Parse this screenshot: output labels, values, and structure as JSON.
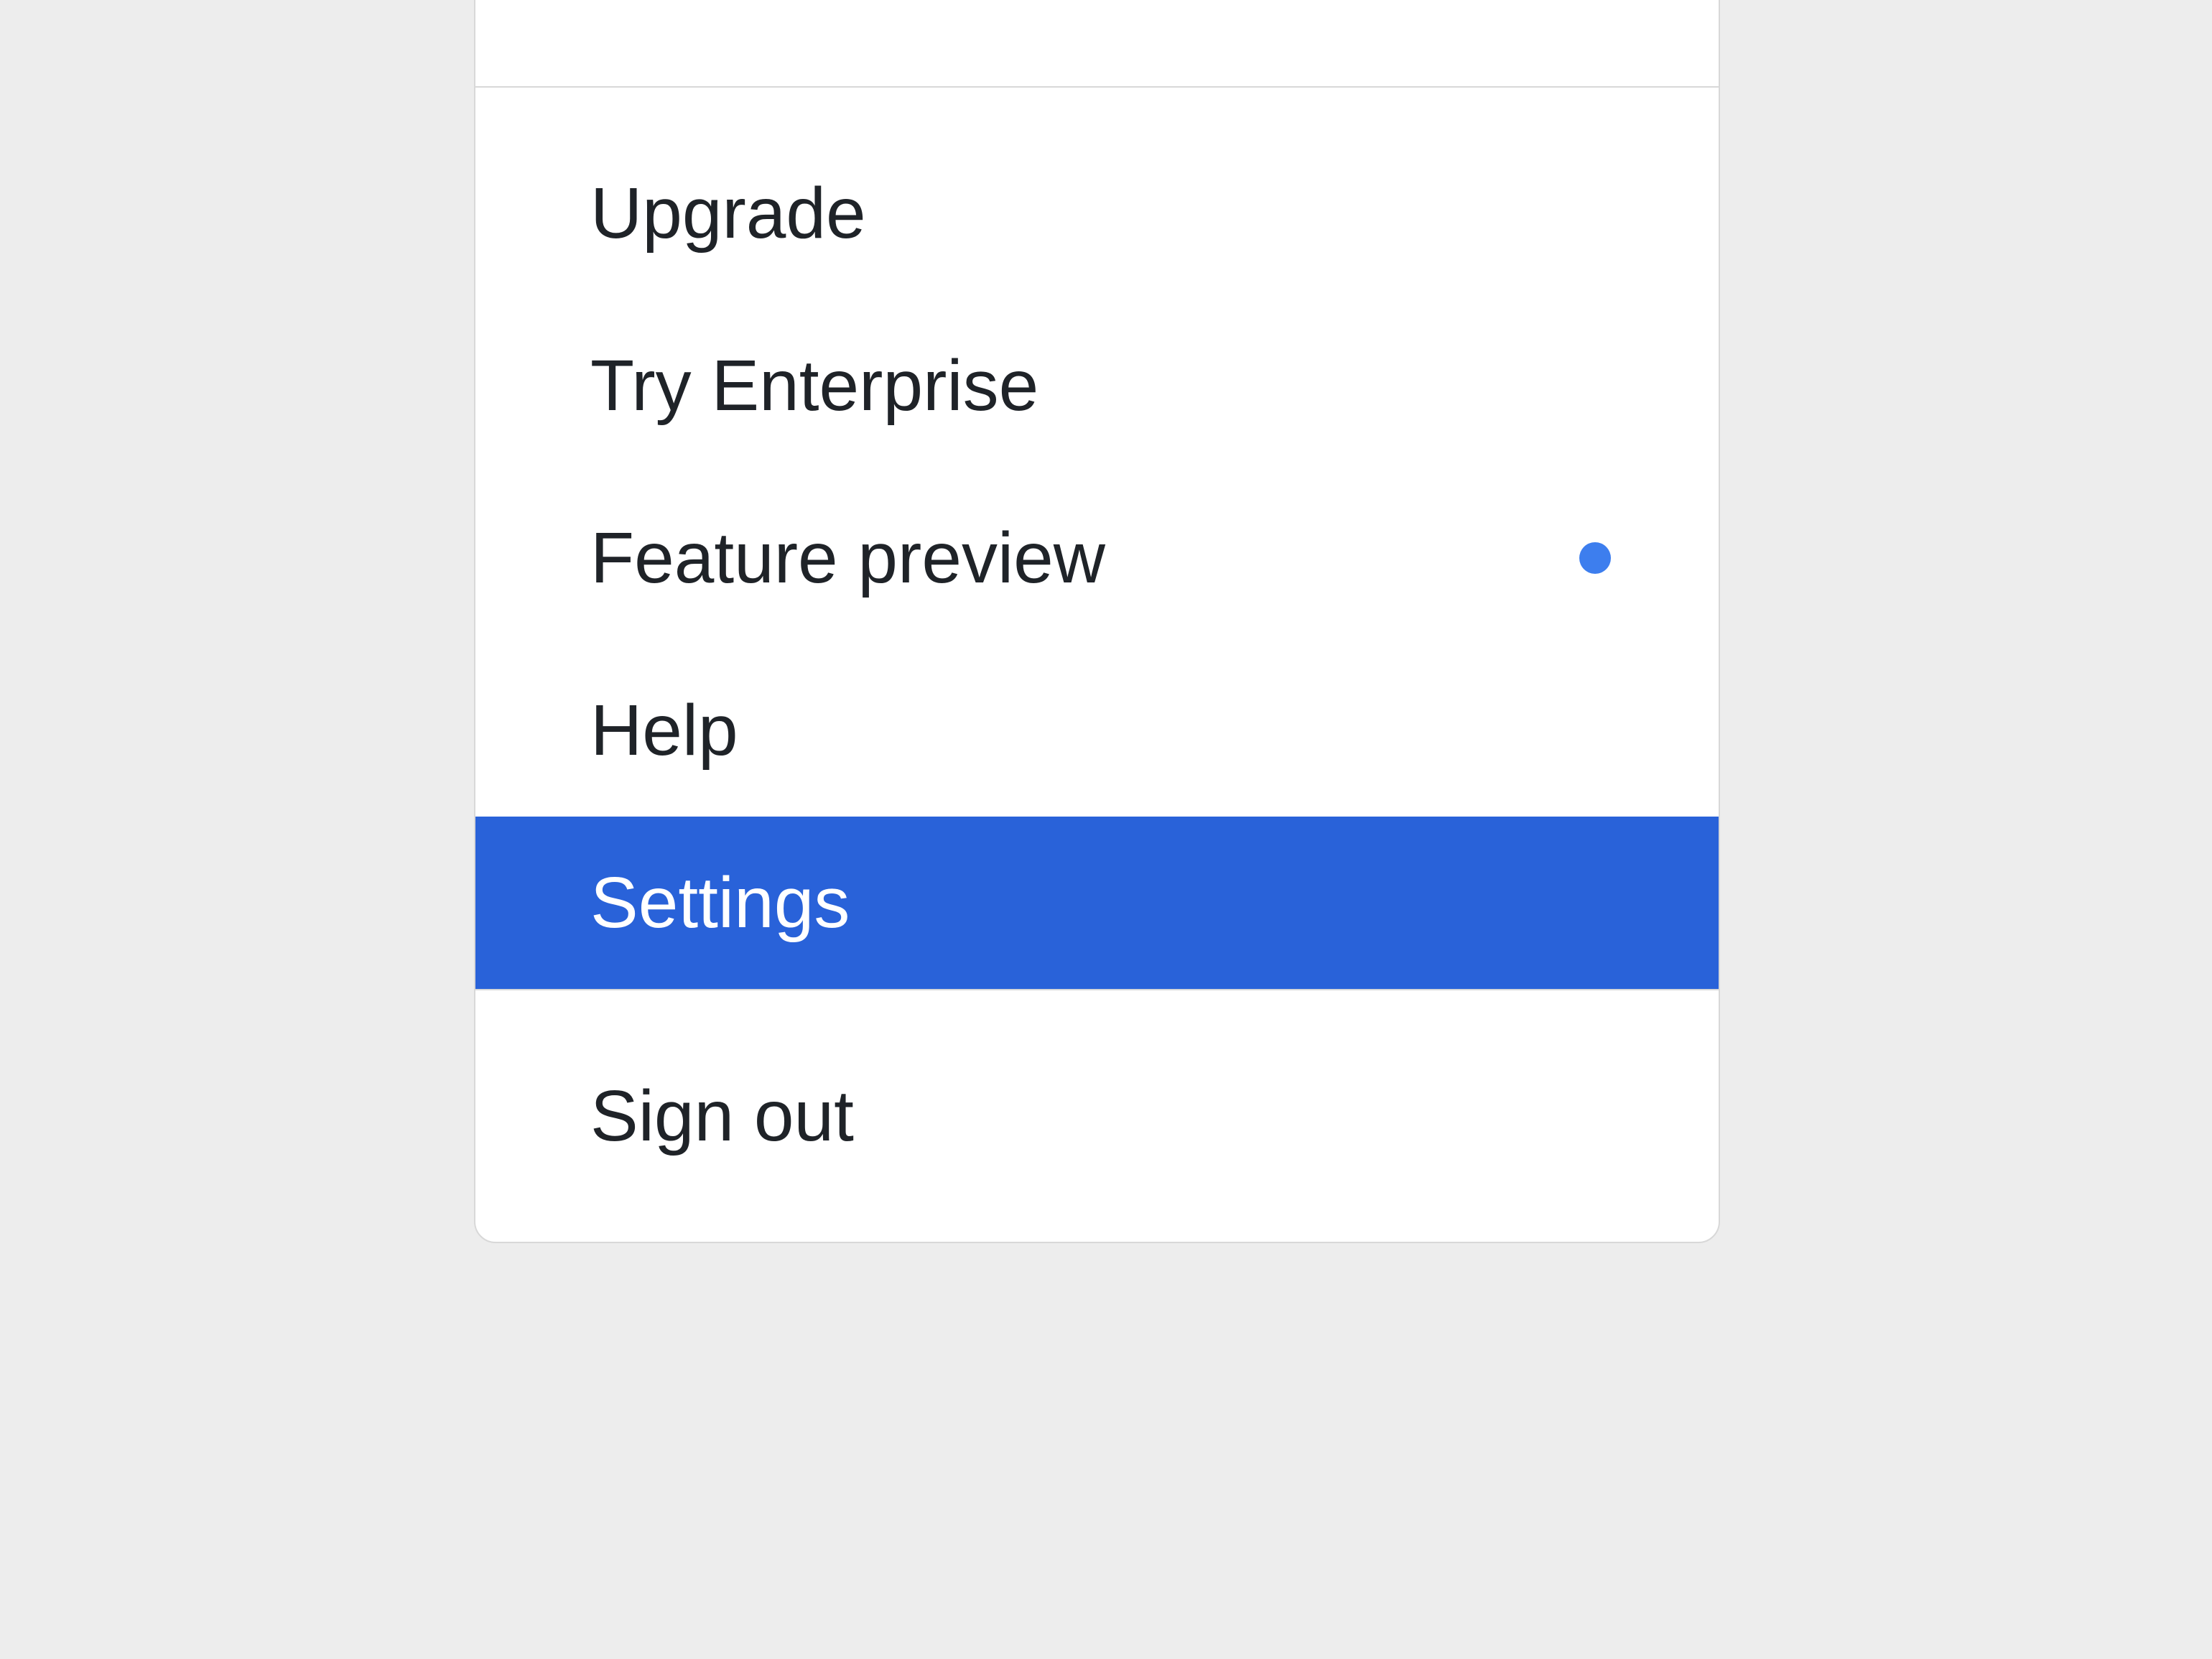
{
  "menu": {
    "items": [
      {
        "label": "Upgrade"
      },
      {
        "label": "Try Enterprise"
      },
      {
        "label": "Feature preview",
        "has_indicator": true
      },
      {
        "label": "Help"
      },
      {
        "label": "Settings",
        "selected": true
      }
    ],
    "signout_label": "Sign out"
  }
}
